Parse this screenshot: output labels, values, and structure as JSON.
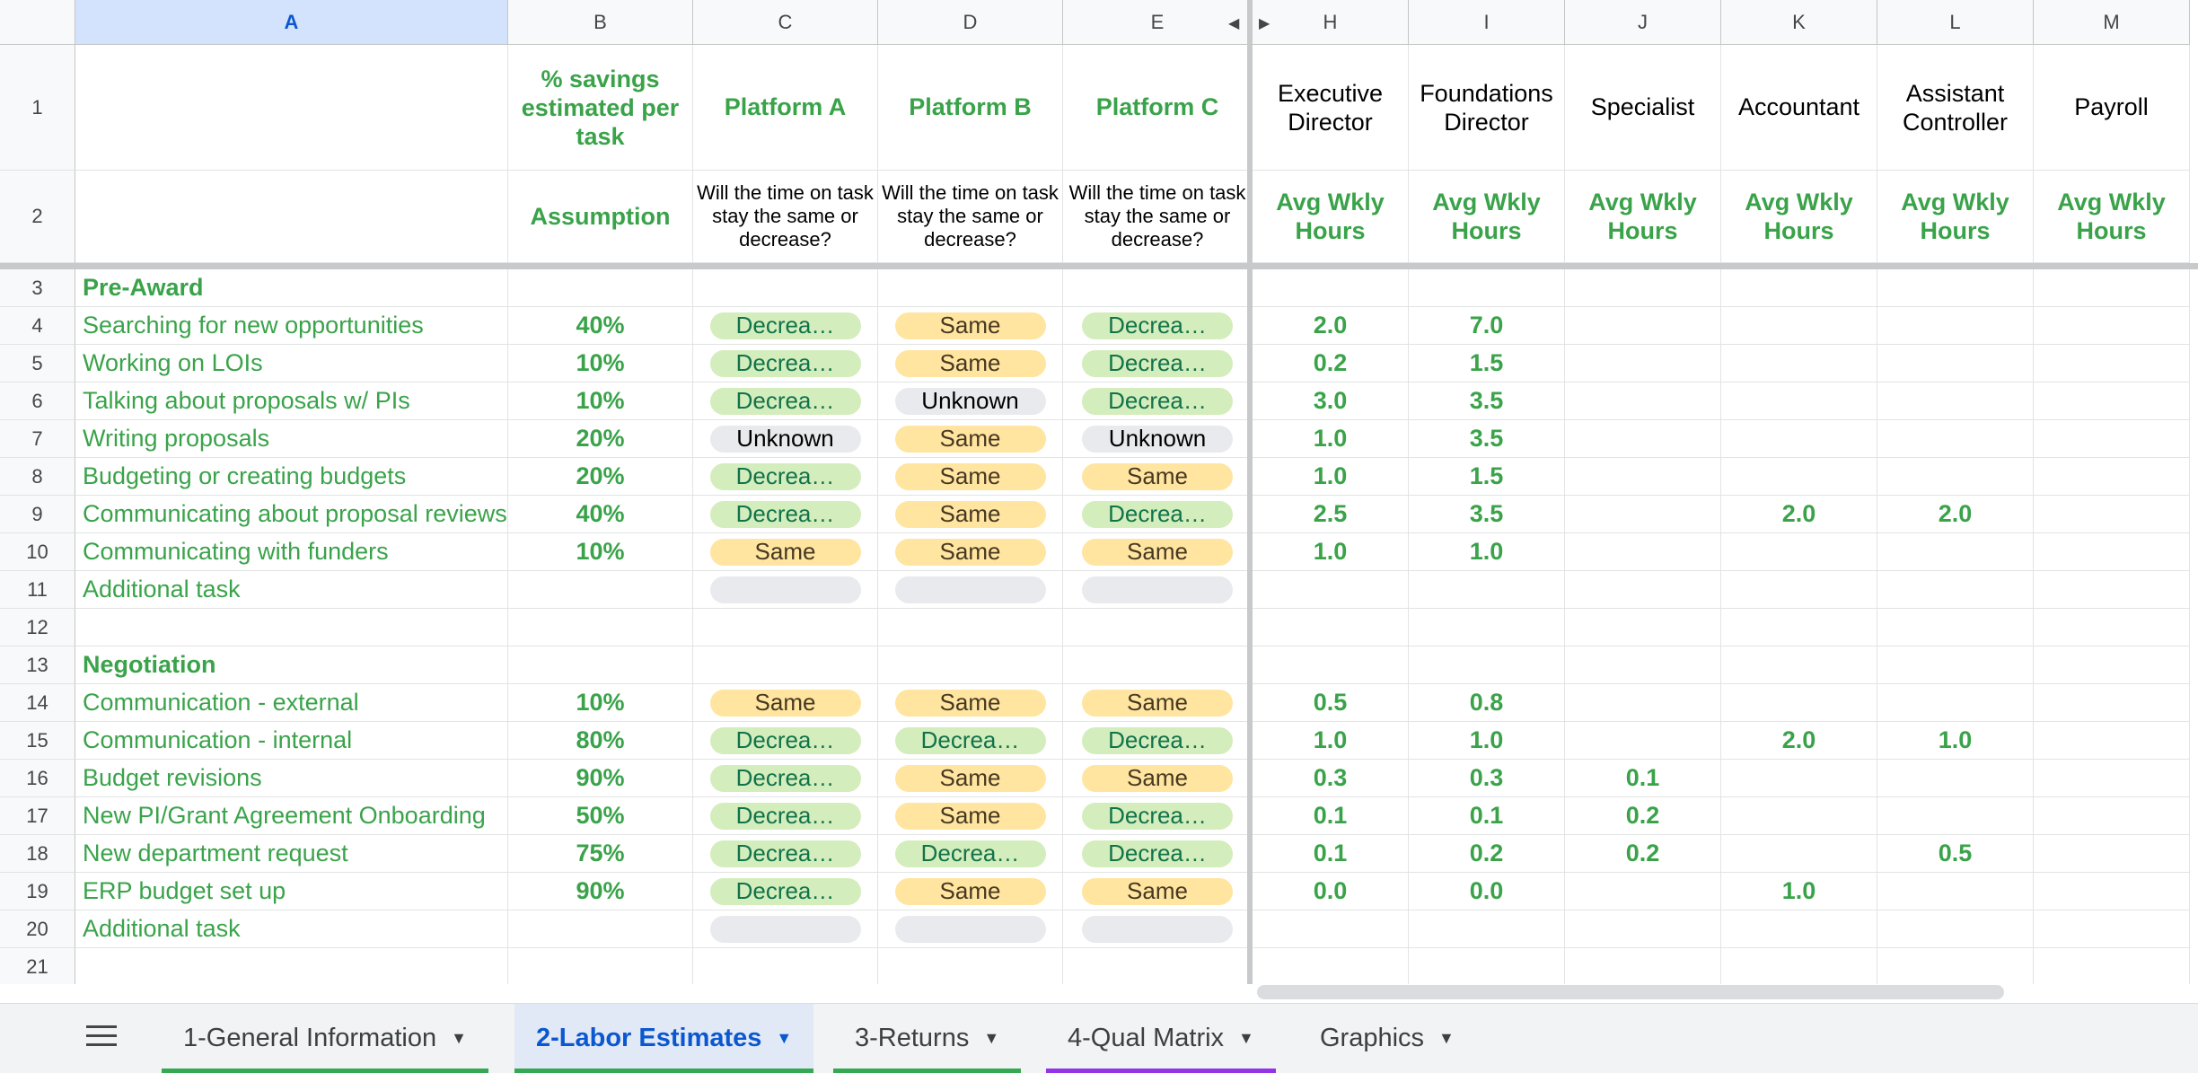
{
  "columns": [
    "A",
    "B",
    "C",
    "D",
    "E",
    "H",
    "I",
    "J",
    "K",
    "L",
    "M"
  ],
  "selected_column": "A",
  "header": {
    "b1": "% savings estimated per task",
    "c1": "Platform A",
    "d1": "Platform B",
    "e1": "Platform C",
    "h1": "Executive Director",
    "i1": "Foundations Director",
    "j1": "Specialist",
    "k1": "Accountant",
    "l1": "Assistant Controller",
    "m1": "Payroll",
    "b2": "Assumption",
    "c2": "Will the time on task stay the same or decrease?",
    "d2": "Will the time on task stay the same or decrease?",
    "e2": "Will the time on task stay the same or decrease?",
    "hours_label": "Avg Wkly Hours"
  },
  "rows": [
    {
      "n": "3",
      "section": "Pre-Award"
    },
    {
      "n": "4",
      "task": "Searching for new opportunities",
      "pct": "40%",
      "c": "Decrea…",
      "d": "Same",
      "e": "Decrea…",
      "h": "2.0",
      "i": "7.0",
      "j": "",
      "k": "",
      "l": "",
      "m": ""
    },
    {
      "n": "5",
      "task": "Working on LOIs",
      "pct": "10%",
      "c": "Decrea…",
      "d": "Same",
      "e": "Decrea…",
      "h": "0.2",
      "i": "1.5",
      "j": "",
      "k": "",
      "l": "",
      "m": ""
    },
    {
      "n": "6",
      "task": "Talking about proposals w/ PIs",
      "pct": "10%",
      "c": "Decrea…",
      "d": "Unknown",
      "e": "Decrea…",
      "h": "3.0",
      "i": "3.5",
      "j": "",
      "k": "",
      "l": "",
      "m": ""
    },
    {
      "n": "7",
      "task": "Writing proposals",
      "pct": "20%",
      "c": "Unknown",
      "d": "Same",
      "e": "Unknown",
      "h": "1.0",
      "i": "3.5",
      "j": "",
      "k": "",
      "l": "",
      "m": ""
    },
    {
      "n": "8",
      "task": "Budgeting or creating budgets",
      "pct": "20%",
      "c": "Decrea…",
      "d": "Same",
      "e": "Same",
      "h": "1.0",
      "i": "1.5",
      "j": "",
      "k": "",
      "l": "",
      "m": ""
    },
    {
      "n": "9",
      "task": "Communicating about proposal reviews",
      "pct": "40%",
      "c": "Decrea…",
      "d": "Same",
      "e": "Decrea…",
      "h": "2.5",
      "i": "3.5",
      "j": "",
      "k": "2.0",
      "l": "2.0",
      "m": ""
    },
    {
      "n": "10",
      "task": "Communicating with funders",
      "pct": "10%",
      "c": "Same",
      "d": "Same",
      "e": "Same",
      "h": "1.0",
      "i": "1.0",
      "j": "",
      "k": "",
      "l": "",
      "m": ""
    },
    {
      "n": "11",
      "task": "Additional task",
      "pct": "",
      "c": "",
      "d": "",
      "e": "",
      "h": "",
      "i": "",
      "j": "",
      "k": "",
      "l": "",
      "m": ""
    },
    {
      "n": "12",
      "empty": true
    },
    {
      "n": "13",
      "section": "Negotiation"
    },
    {
      "n": "14",
      "task": "Communication - external",
      "pct": "10%",
      "c": "Same",
      "d": "Same",
      "e": "Same",
      "h": "0.5",
      "i": "0.8",
      "j": "",
      "k": "",
      "l": "",
      "m": ""
    },
    {
      "n": "15",
      "task": "Communication - internal",
      "pct": "80%",
      "c": "Decrea…",
      "d": "Decrea…",
      "e": "Decrea…",
      "h": "1.0",
      "i": "1.0",
      "j": "",
      "k": "2.0",
      "l": "1.0",
      "m": ""
    },
    {
      "n": "16",
      "task": "Budget revisions",
      "pct": "90%",
      "c": "Decrea…",
      "d": "Same",
      "e": "Same",
      "h": "0.3",
      "i": "0.3",
      "j": "0.1",
      "k": "",
      "l": "",
      "m": ""
    },
    {
      "n": "17",
      "task": "New PI/Grant Agreement Onboarding",
      "pct": "50%",
      "c": "Decrea…",
      "d": "Same",
      "e": "Decrea…",
      "h": "0.1",
      "i": "0.1",
      "j": "0.2",
      "k": "",
      "l": "",
      "m": ""
    },
    {
      "n": "18",
      "task": "New department request",
      "pct": "75%",
      "c": "Decrea…",
      "d": "Decrea…",
      "e": "Decrea…",
      "h": "0.1",
      "i": "0.2",
      "j": "0.2",
      "k": "",
      "l": "0.5",
      "m": ""
    },
    {
      "n": "19",
      "task": "ERP budget set up",
      "pct": "90%",
      "c": "Decrea…",
      "d": "Same",
      "e": "Same",
      "h": "0.0",
      "i": "0.0",
      "j": "",
      "k": "1.0",
      "l": "",
      "m": ""
    },
    {
      "n": "20",
      "task": "Additional task",
      "pct": "",
      "c": "",
      "d": "",
      "e": "",
      "h": "",
      "i": "",
      "j": "",
      "k": "",
      "l": "",
      "m": ""
    },
    {
      "n": "21",
      "empty": true
    }
  ],
  "tabs": [
    {
      "label": "1-General Information",
      "active": false,
      "color": "#34a853"
    },
    {
      "label": "2-Labor Estimates",
      "active": true,
      "color": "#34a853"
    },
    {
      "label": "3-Returns",
      "active": false,
      "color": "#34a853"
    },
    {
      "label": "4-Qual Matrix",
      "active": false,
      "color": "#9334e6"
    },
    {
      "label": "Graphics",
      "active": false,
      "color": ""
    }
  ],
  "icons": {
    "menu": "hamburger-menu-icon",
    "dropdown": "dropdown-arrow-icon",
    "expand_left": "triangle-left-icon",
    "expand_right": "triangle-right-icon"
  }
}
